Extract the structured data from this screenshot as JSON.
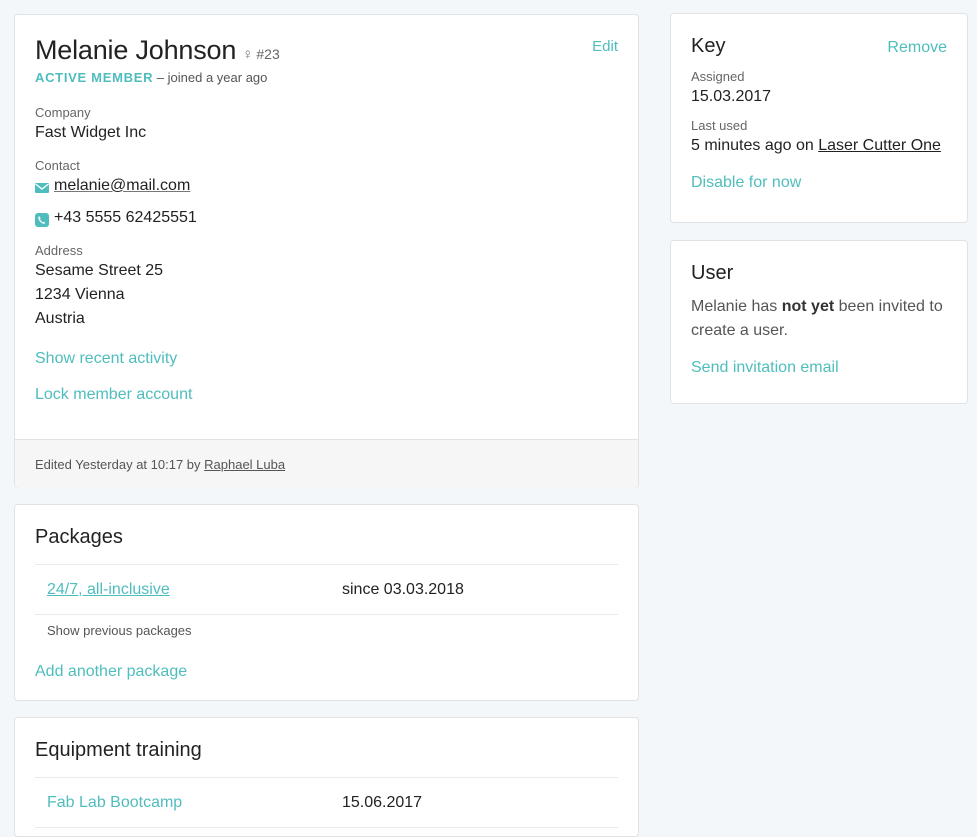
{
  "colors": {
    "accent": "#4fbdbd",
    "background": "#f3f7f9",
    "card": "#ffffff",
    "footer": "#f6f6f7"
  },
  "member": {
    "name": "Melanie Johnson",
    "gender_icon": "female-symbol",
    "gender_glyph": "♀",
    "member_number": "#23",
    "status": "ACTIVE MEMBER",
    "joined": "– joined a year ago",
    "edit_label": "Edit",
    "company_label": "Company",
    "company": "Fast Widget Inc",
    "contact_label": "Contact",
    "email": "melanie@mail.com",
    "email_icon": "envelope-icon",
    "phone": "+43 5555 62425551",
    "phone_icon": "phone-icon",
    "address_label": "Address",
    "address_lines": [
      "Sesame Street 25",
      "1234 Vienna",
      "Austria"
    ],
    "actions": [
      "Show recent activity",
      "Lock member account"
    ],
    "footer": {
      "prefix": "Edited Yesterday at 10:17 by",
      "editor": "Raphael Luba"
    }
  },
  "packages": {
    "title": "Packages",
    "rows": [
      {
        "name": "24/7, all-inclusive",
        "since": "since 03.03.2018"
      }
    ],
    "show_previous": "Show previous packages",
    "add_label": "Add another package"
  },
  "training": {
    "title": "Equipment training",
    "rows": [
      {
        "name": "Fab Lab Bootcamp",
        "date": "15.06.2017"
      }
    ]
  },
  "key": {
    "title": "Key",
    "remove_label": "Remove",
    "assigned_label": "Assigned",
    "assigned": "15.03.2017",
    "last_used_label": "Last used",
    "last_used_prefix": "5 minutes ago on",
    "last_used_device": "Laser Cutter One",
    "disable_label": "Disable for now"
  },
  "user": {
    "title": "User",
    "text_before": "Melanie has",
    "text_bold": "not yet",
    "text_after": "been invited to create a user.",
    "invite_label": "Send invitation email"
  }
}
